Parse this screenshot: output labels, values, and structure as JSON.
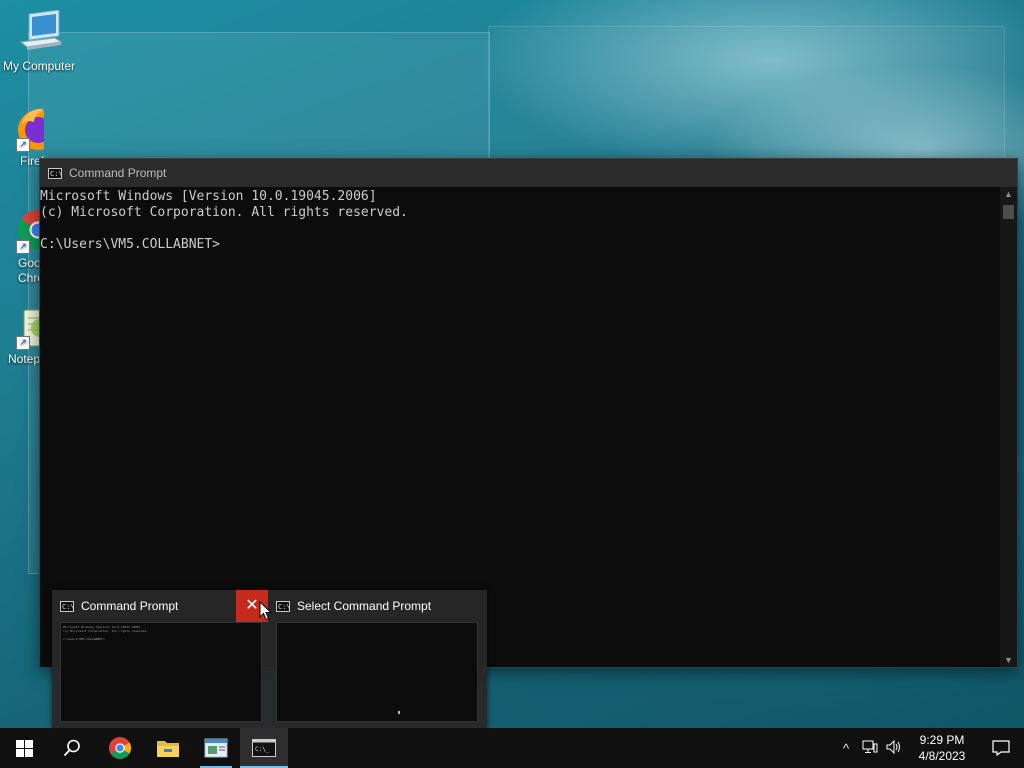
{
  "desktop": {
    "icons": [
      {
        "label": "My Computer"
      },
      {
        "label": "Firefox"
      },
      {
        "label": "Google Chrome"
      },
      {
        "label": "Notepad++"
      }
    ]
  },
  "cmd_window": {
    "title": "Command Prompt",
    "lines": [
      "Microsoft Windows [Version 10.0.19045.2006]",
      "(c) Microsoft Corporation. All rights reserved.",
      "",
      "C:\\Users\\VM5.COLLABNET>"
    ]
  },
  "thumbnails": [
    {
      "title": "Command Prompt"
    },
    {
      "title": "Select Command Prompt"
    }
  ],
  "taskbar": {
    "clock_time": "9:29 PM",
    "clock_date": "4/8/2023",
    "accent": "#76b9ed"
  }
}
